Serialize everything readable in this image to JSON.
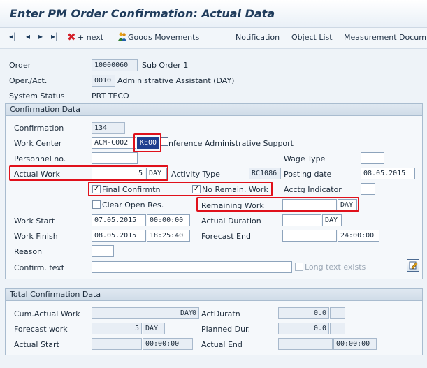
{
  "window": {
    "title": "Enter PM Order Confirmation: Actual Data"
  },
  "toolbar": {
    "nav_first": "◂|",
    "nav_prev": "◂",
    "nav_next": "▸",
    "nav_last": "▸|",
    "delete_next": "+ next",
    "goods_movements": "Goods Movements",
    "notification": "Notification",
    "object_list": "Object List",
    "measurement_documents": "Measurement Docum"
  },
  "header": {
    "order_label": "Order",
    "order_value": "10000060",
    "sub_order_text": "Sub Order 1",
    "oper_label": "Oper./Act.",
    "oper_value": "0010",
    "oper_text": "Administrative Assistant (DAY)",
    "status_label": "System Status",
    "status_value": "PRT  TECO"
  },
  "confirmation": {
    "section_title": "Confirmation Data",
    "confirmation_label": "Confirmation",
    "confirmation_value": "134",
    "work_center_label": "Work Center",
    "work_center_value": "ACM-C002",
    "plant_value": "KE00",
    "work_center_text": "nference Administrative Support",
    "personnel_label": "Personnel no.",
    "personnel_value": "",
    "wage_type_label": "Wage Type",
    "wage_type_value": "",
    "actual_work_label": "Actual Work",
    "actual_work_value": "5",
    "actual_work_unit": "DAY",
    "activity_type_label": "Activity Type",
    "activity_type_value": "RC1086",
    "posting_date_label": "Posting date",
    "posting_date_value": "08.05.2015",
    "final_confirm_label": "Final Confirmtn",
    "final_confirm_checked": true,
    "no_remain_label": "No Remain. Work",
    "no_remain_checked": true,
    "acctg_indicator_label": "Acctg Indicator",
    "acctg_indicator_value": "",
    "clear_open_label": "Clear Open Res.",
    "clear_open_checked": false,
    "remaining_work_label": "Remaining Work",
    "remaining_work_value": "",
    "remaining_work_unit": "DAY",
    "work_start_label": "Work Start",
    "work_start_date": "07.05.2015",
    "work_start_time": "00:00:00",
    "actual_duration_label": "Actual Duration",
    "actual_duration_value": "",
    "actual_duration_unit": "DAY",
    "work_finish_label": "Work Finish",
    "work_finish_date": "08.05.2015",
    "work_finish_time": "18:25:40",
    "forecast_end_label": "Forecast End",
    "forecast_end_date": "",
    "forecast_end_time": "24:00:00",
    "reason_label": "Reason",
    "reason_value": "",
    "confirm_text_label": "Confirm. text",
    "confirm_text_value": "",
    "long_text_label": "Long text exists",
    "long_text_checked": false
  },
  "totals": {
    "section_title": "Total Confirmation Data",
    "cum_actual_label": "Cum.Actual Work",
    "cum_actual_value": "0",
    "cum_actual_unit": "DAY",
    "act_duration_label": "ActDuratn",
    "act_duration_value": "0.0",
    "forecast_work_label": "Forecast work",
    "forecast_work_value": "5",
    "forecast_work_unit": "DAY",
    "planned_dur_label": "Planned Dur.",
    "planned_dur_value": "0.0",
    "actual_start_label": "Actual Start",
    "actual_start_time": "00:00:00",
    "actual_end_label": "Actual End",
    "actual_end_time": "00:00:00"
  },
  "colors": {
    "highlight": "#e0111b",
    "title": "#203c5c",
    "accent": "#1f3f8f"
  },
  "icons": {
    "delete": "red-x-icon",
    "goods": "people-icon",
    "edit": "edit-pencil-icon",
    "copy": "copy-icon"
  }
}
